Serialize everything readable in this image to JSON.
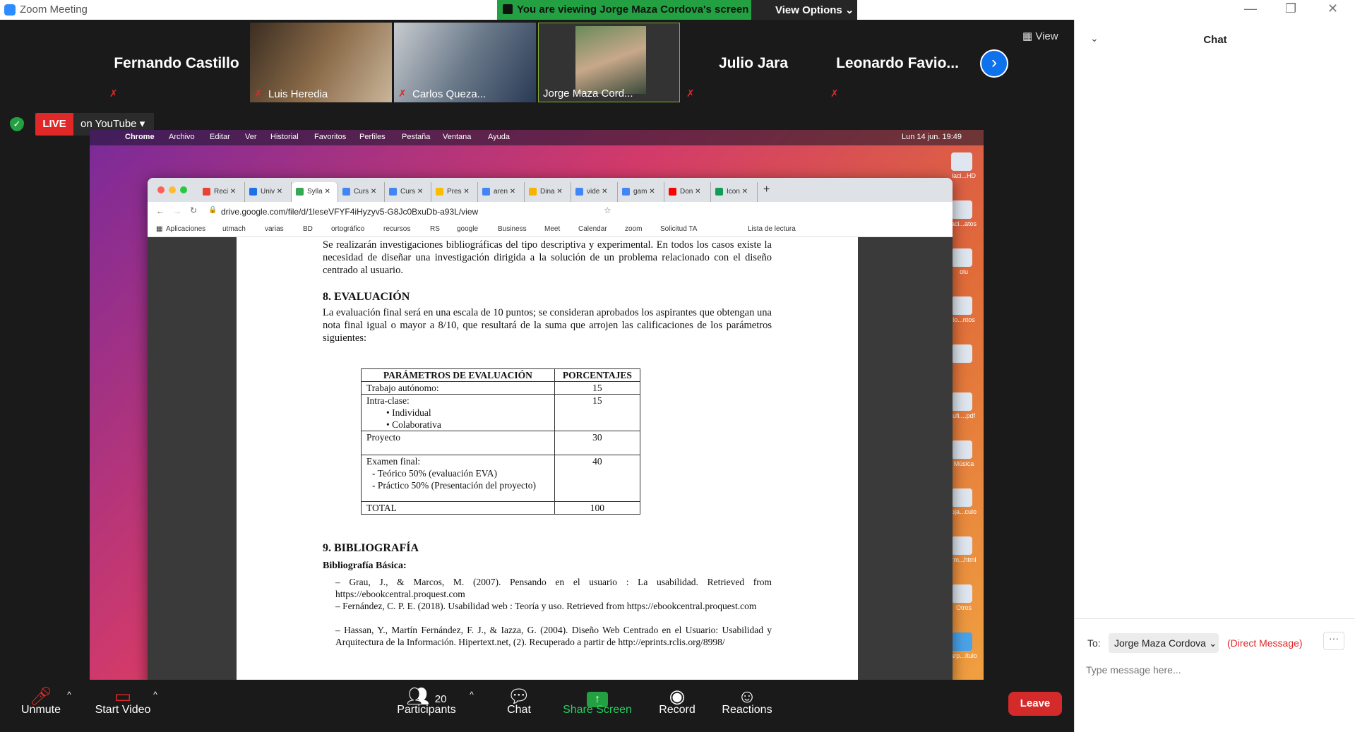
{
  "window": {
    "title": "Zoom Meeting",
    "minimize": "—",
    "restore": "❐",
    "close": "✕"
  },
  "banner": {
    "viewing": "You are viewing Jorge Maza Cordova's screen",
    "view_options": "View Options ⌄"
  },
  "gallery": {
    "tiles": [
      {
        "name": "Fernando Castillo",
        "type": "name"
      },
      {
        "name": "Luis Heredia",
        "type": "video"
      },
      {
        "name": "Carlos Queza...",
        "type": "video"
      },
      {
        "name": "Jorge Maza Cord...",
        "type": "video"
      },
      {
        "name": "Julio Jara",
        "type": "name"
      },
      {
        "name": "Leonardo Favio...",
        "type": "name"
      }
    ],
    "view_label": "View"
  },
  "stream": {
    "live": "LIVE",
    "platform": "on YouTube"
  },
  "mac_menu": [
    "Chrome",
    "Archivo",
    "Editar",
    "Ver",
    "Historial",
    "Favoritos",
    "Perfiles",
    "Pestaña",
    "Ventana",
    "Ayuda"
  ],
  "mac_clock": "Lun 14 jun.  19:49",
  "dock": [
    "laci...HD",
    "aci...atos",
    "oiu",
    "lo...ntos",
    "",
    "ufi....pdf",
    "Música",
    "oja...culo",
    "rm...html",
    "Otros",
    "arp...ítulo"
  ],
  "chrome": {
    "tabs": [
      "Reci",
      "Univ",
      "Sylla",
      "Curs",
      "Curs",
      "Pres",
      "aren",
      "Dina",
      "vide",
      "gam",
      "Don",
      "Icon"
    ],
    "url": "drive.google.com/file/d/1leseVFYF4iHyzyv5-G8Jc0BxuDb-a93L/view",
    "bookmarks": [
      "Aplicaciones",
      "utmach",
      "varias",
      "BD",
      "ortográfico",
      "recursos",
      "RS",
      "google",
      "Business",
      "Meet",
      "Calendar",
      "zoom",
      "Solicitud TA",
      "Lista de lectura"
    ]
  },
  "document": {
    "intro": "Se realizarán investigaciones bibliográficas del tipo descriptiva y experimental. En todos los casos existe la necesidad de diseñar una investigación dirigida a la solución de un problema relacionado con el diseño centrado al usuario.",
    "eval_heading": "8. EVALUACIÓN",
    "eval_text": "La evaluación final será en una escala de 10 puntos; se consideran aprobados los aspirantes que obtengan una nota final igual o mayor a 8/10, que resultará de la suma que arrojen las calificaciones de los parámetros siguientes:",
    "table": {
      "headers": [
        "PARÁMETROS DE EVALUACIÓN",
        "PORCENTAJES"
      ],
      "rows": [
        {
          "param": "Trabajo autónomo:",
          "pct": "15"
        },
        {
          "param": "Intra-clase:",
          "sub": [
            "Individual",
            "Colaborativa"
          ],
          "pct": "15"
        },
        {
          "param": "Proyecto",
          "pct": "30"
        },
        {
          "param": "Examen final:",
          "sub": [
            "Teórico 50% (evaluación EVA)",
            "Práctico 50% (Presentación del proyecto)"
          ],
          "pct": "40"
        },
        {
          "param": "TOTAL",
          "pct": "100"
        }
      ]
    },
    "bib_heading": "9. BIBLIOGRAFÍA",
    "bib_sub": "Bibliografía Básica:",
    "bib": [
      "Grau, J., & Marcos, M. (2007). Pensando en el usuario : La usabilidad. Retrieved from https://ebookcentral.proquest.com",
      "Fernández, C. P. E. (2018). Usabilidad web : Teoría y uso. Retrieved from https://ebookcentral.proquest.com",
      "Hassan, Y., Martín Fernández, F. J., & Iazza, G. (2004). Diseño Web Centrado en el Usuario: Usabilidad y Arquitectura de la Información. Hipertext.net, (2). Recuperado a partir de http://eprints.rclis.org/8998/"
    ]
  },
  "toolbar": {
    "unmute": "Unmute",
    "start_video": "Start Video",
    "participants": "Participants",
    "participant_count": "20",
    "chat": "Chat",
    "share": "Share Screen",
    "record": "Record",
    "reactions": "Reactions",
    "leave": "Leave"
  },
  "chat": {
    "title": "Chat",
    "to_label": "To:",
    "recipient": "Jorge Maza Cordova",
    "direct": "(Direct Message)",
    "placeholder": "Type message here...",
    "more": "···"
  }
}
